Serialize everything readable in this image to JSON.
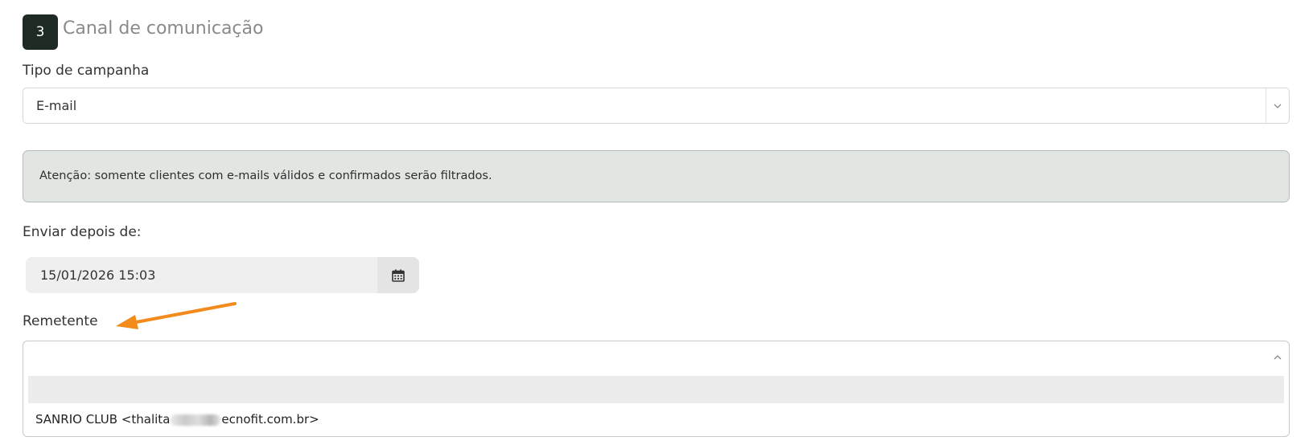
{
  "section": {
    "step_number": "3",
    "title": "Canal de comunicação"
  },
  "campaign_type": {
    "label": "Tipo de campanha",
    "value": "E-mail"
  },
  "alert": {
    "text": "Atenção: somente clientes com e-mails válidos e confirmados serão filtrados."
  },
  "send_after": {
    "label": "Enviar depois de:",
    "value": "15/01/2026 15:03",
    "button_icon": "calendar-icon"
  },
  "sender": {
    "label": "Remetente",
    "selected_value": "",
    "options": [
      {
        "label": ""
      },
      {
        "label_prefix": "SANRIO CLUB <thalita",
        "label_suffix": "ecnofit.com.br>"
      }
    ]
  },
  "annotation": {
    "arrow_color": "#f28a1c"
  },
  "colors": {
    "badge_bg": "#1e2b24",
    "alert_bg": "#e2e6e2",
    "alert_border": "#b7bbb7"
  }
}
